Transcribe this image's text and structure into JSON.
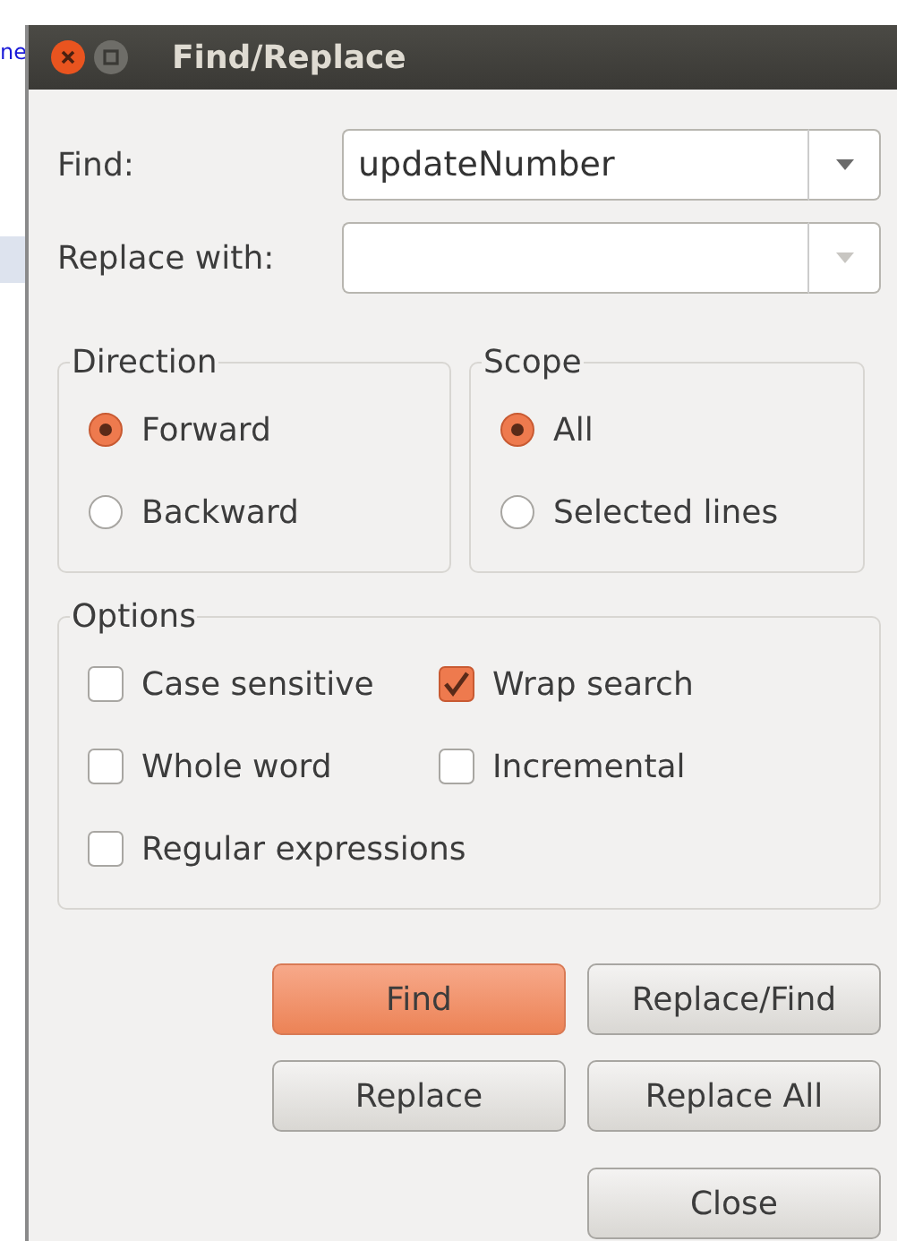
{
  "editor": {
    "text": "ne"
  },
  "window": {
    "title": "Find/Replace"
  },
  "fields": [
    {
      "label": "Find:",
      "value": "updateNumber",
      "disabled": false
    },
    {
      "label": "Replace with:",
      "disabled": true
    }
  ],
  "direction": {
    "title": "Direction",
    "options": [
      {
        "label": "Forward",
        "selected": true
      },
      {
        "label": "Backward",
        "selected": false
      }
    ]
  },
  "scope": {
    "title": "Scope",
    "options": [
      {
        "label": "All",
        "selected": true
      },
      {
        "label": "Selected lines",
        "selected": false
      }
    ]
  },
  "options": {
    "title": "Options",
    "items": [
      {
        "label": "Case sensitive",
        "checked": false
      },
      {
        "label": "Wrap search",
        "checked": true
      },
      {
        "label": "Whole word",
        "checked": false
      },
      {
        "label": "Incremental",
        "checked": false
      },
      {
        "label": "Regular expressions",
        "checked": false
      }
    ]
  },
  "buttons": [
    {
      "label": "Find",
      "default": true
    },
    {
      "label": "Replace/Find",
      "default": false
    },
    {
      "label": "Replace",
      "default": false
    },
    {
      "label": "Replace All",
      "default": false
    },
    {
      "label": "Close",
      "default": false
    }
  ]
}
